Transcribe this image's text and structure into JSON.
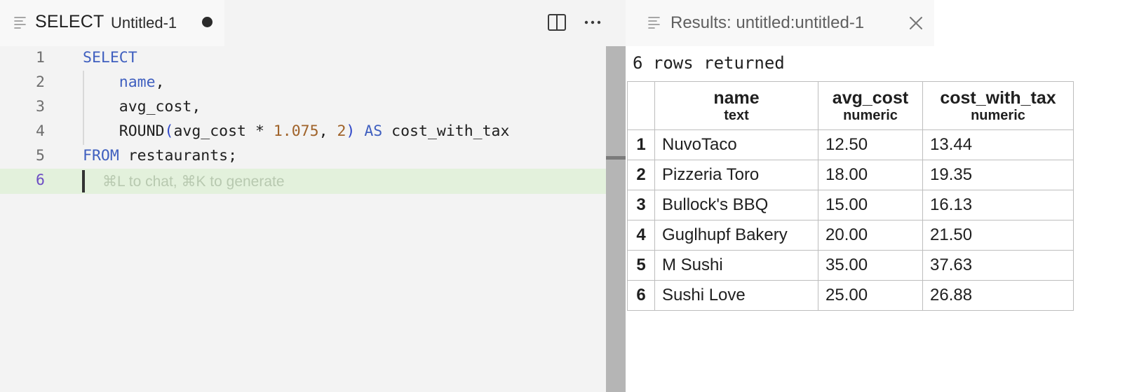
{
  "editor": {
    "tab": {
      "keyword": "SELECT",
      "file_name": "Untitled-1",
      "unsaved": true
    },
    "icons": {
      "tab_icon": "lines-icon",
      "split": "split-editor-icon",
      "more": "ellipsis-icon"
    },
    "lines": [
      {
        "number": "1",
        "tokens": [
          {
            "t": "SELECT",
            "k": "kw"
          }
        ]
      },
      {
        "number": "2",
        "tokens": [
          {
            "t": "    "
          },
          {
            "t": "name",
            "k": "kw"
          },
          {
            "t": ","
          }
        ]
      },
      {
        "number": "3",
        "tokens": [
          {
            "t": "    avg_cost,"
          }
        ]
      },
      {
        "number": "4",
        "tokens": [
          {
            "t": "    ROUND"
          },
          {
            "t": "(",
            "k": "paren"
          },
          {
            "t": "avg_cost * "
          },
          {
            "t": "1.075",
            "k": "num"
          },
          {
            "t": ", "
          },
          {
            "t": "2",
            "k": "num"
          },
          {
            "t": ")",
            "k": "paren"
          },
          {
            "t": " "
          },
          {
            "t": "AS",
            "k": "kw"
          },
          {
            "t": " cost_with_tax"
          }
        ]
      },
      {
        "number": "5",
        "tokens": [
          {
            "t": "FROM",
            "k": "kw"
          },
          {
            "t": " restaurants;"
          }
        ]
      },
      {
        "number": "6",
        "tokens": []
      }
    ],
    "ghost_hint": "⌘L to chat, ⌘K to generate"
  },
  "results": {
    "tab_title": "Results: untitled:untitled-1",
    "summary": "6 rows returned",
    "columns": [
      {
        "name": "name",
        "type": "text"
      },
      {
        "name": "avg_cost",
        "type": "numeric"
      },
      {
        "name": "cost_with_tax",
        "type": "numeric"
      }
    ],
    "rows": [
      {
        "index": "1",
        "name": "NuvoTaco",
        "avg_cost": "12.50",
        "cost_with_tax": "13.44"
      },
      {
        "index": "2",
        "name": "Pizzeria Toro",
        "avg_cost": "18.00",
        "cost_with_tax": "19.35"
      },
      {
        "index": "3",
        "name": "Bullock's BBQ",
        "avg_cost": "15.00",
        "cost_with_tax": "16.13"
      },
      {
        "index": "4",
        "name": "Guglhupf Bakery",
        "avg_cost": "20.00",
        "cost_with_tax": "21.50"
      },
      {
        "index": "5",
        "name": "M Sushi",
        "avg_cost": "35.00",
        "cost_with_tax": "37.63"
      },
      {
        "index": "6",
        "name": "Sushi Love",
        "avg_cost": "25.00",
        "cost_with_tax": "26.88"
      }
    ]
  }
}
